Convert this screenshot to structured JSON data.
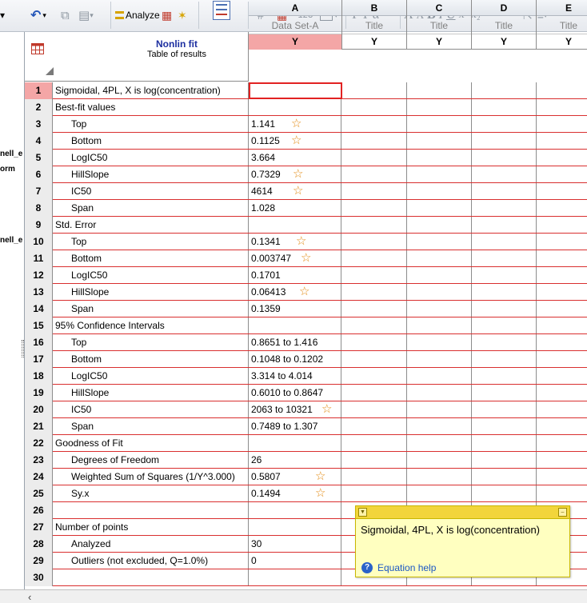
{
  "toolbar": {
    "analyze_label": "Analyze",
    "subscript_label": "123",
    "format_glyphs": [
      "T",
      "T",
      "α",
      "A",
      "A",
      "B",
      "I",
      "U",
      "x²",
      "x₂"
    ]
  },
  "left_strip": {
    "fragments": [
      "nell_e",
      "orm",
      "nell_e"
    ]
  },
  "sheet": {
    "title": "Nonlin fit",
    "subtitle": "Table of results",
    "columns": [
      {
        "letter": "A",
        "title": "Data Set-A",
        "y": "Y"
      },
      {
        "letter": "B",
        "title": "Title",
        "y": "Y"
      },
      {
        "letter": "C",
        "title": "Title",
        "y": "Y"
      },
      {
        "letter": "D",
        "title": "Title",
        "y": "Y"
      },
      {
        "letter": "E",
        "title": "Title",
        "y": "Y"
      }
    ],
    "rows": [
      {
        "n": "1",
        "label": "Sigmoidal, 4PL, X is log(concentration)",
        "value": "",
        "indent": false,
        "star": false
      },
      {
        "n": "2",
        "label": "Best-fit values",
        "value": "",
        "indent": false,
        "star": false
      },
      {
        "n": "3",
        "label": "Top",
        "value": "1.141",
        "indent": true,
        "star": true
      },
      {
        "n": "4",
        "label": "Bottom",
        "value": "0.1125",
        "indent": true,
        "star": true
      },
      {
        "n": "5",
        "label": "LogIC50",
        "value": "3.664",
        "indent": true,
        "star": false
      },
      {
        "n": "6",
        "label": "HillSlope",
        "value": "0.7329",
        "indent": true,
        "star": true
      },
      {
        "n": "7",
        "label": "IC50",
        "value": "4614",
        "indent": true,
        "star": true
      },
      {
        "n": "8",
        "label": "Span",
        "value": "1.028",
        "indent": true,
        "star": false
      },
      {
        "n": "9",
        "label": "Std. Error",
        "value": "",
        "indent": false,
        "star": false
      },
      {
        "n": "10",
        "label": "Top",
        "value": "0.1341",
        "indent": true,
        "star": true
      },
      {
        "n": "11",
        "label": "Bottom",
        "value": "0.003747",
        "indent": true,
        "star": true
      },
      {
        "n": "12",
        "label": "LogIC50",
        "value": "0.1701",
        "indent": true,
        "star": false
      },
      {
        "n": "13",
        "label": "HillSlope",
        "value": "0.06413",
        "indent": true,
        "star": true
      },
      {
        "n": "14",
        "label": "Span",
        "value": "0.1359",
        "indent": true,
        "star": false
      },
      {
        "n": "15",
        "label": "95% Confidence Intervals",
        "value": "",
        "indent": false,
        "star": false
      },
      {
        "n": "16",
        "label": "Top",
        "value": "0.8651 to 1.416",
        "indent": true,
        "star": false
      },
      {
        "n": "17",
        "label": "Bottom",
        "value": "0.1048 to 0.1202",
        "indent": true,
        "star": false
      },
      {
        "n": "18",
        "label": "LogIC50",
        "value": "3.314 to 4.014",
        "indent": true,
        "star": false
      },
      {
        "n": "19",
        "label": "HillSlope",
        "value": "0.6010 to 0.8647",
        "indent": true,
        "star": false
      },
      {
        "n": "20",
        "label": "IC50",
        "value": "2063 to 10321",
        "indent": true,
        "star": true
      },
      {
        "n": "21",
        "label": "Span",
        "value": "0.7489 to 1.307",
        "indent": true,
        "star": false
      },
      {
        "n": "22",
        "label": "Goodness of Fit",
        "value": "",
        "indent": false,
        "star": false
      },
      {
        "n": "23",
        "label": "Degrees of Freedom",
        "value": "26",
        "indent": true,
        "star": false
      },
      {
        "n": "24",
        "label": "Weighted Sum of Squares (1/Y^3.000)",
        "value": "0.5807",
        "indent": true,
        "star": true
      },
      {
        "n": "25",
        "label": "Sy.x",
        "value": "0.1494",
        "indent": true,
        "star": true
      },
      {
        "n": "26",
        "label": "",
        "value": "",
        "indent": false,
        "star": false
      },
      {
        "n": "27",
        "label": "Number of points",
        "value": "",
        "indent": false,
        "star": false
      },
      {
        "n": "28",
        "label": "Analyzed",
        "value": "30",
        "indent": true,
        "star": false
      },
      {
        "n": "29",
        "label": "Outliers (not excluded, Q=1.0%)",
        "value": "0",
        "indent": true,
        "star": false
      },
      {
        "n": "30",
        "label": "",
        "value": "",
        "indent": false,
        "star": false
      }
    ]
  },
  "note": {
    "text": "Sigmoidal, 4PL, X is log(concentration)",
    "help_link": "Equation help"
  },
  "colors": {
    "row_line": "#d92f2f",
    "selected_header": "#f4a6a6",
    "star": "#e28a12",
    "note_bg": "#ffffc0"
  }
}
